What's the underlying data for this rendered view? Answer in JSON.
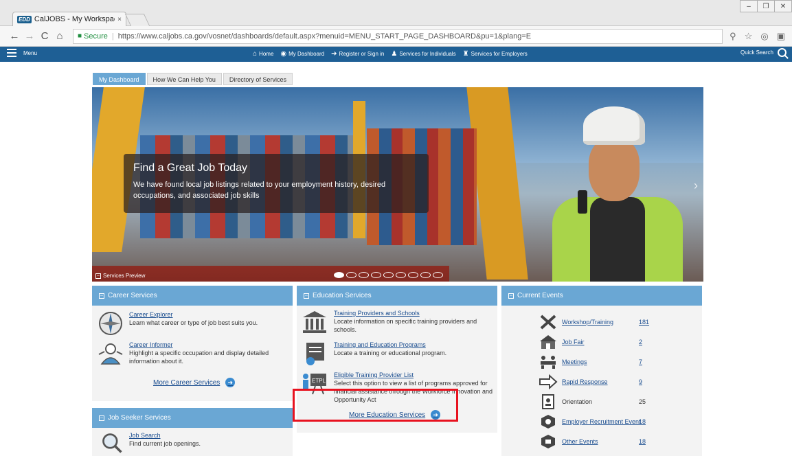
{
  "browser": {
    "tab_favicon": "EDD",
    "tab_title": "CalJOBS - My Workspace",
    "tab_close": "×",
    "secure_label": "Secure",
    "url": "https://www.caljobs.ca.gov/vosnet/dashboards/default.aspx?menuid=MENU_START_PAGE_DASHBOARD&pu=1&plang=E",
    "window_controls": [
      "–",
      "❐",
      "✕"
    ]
  },
  "site_nav": {
    "menu_label": "Menu",
    "links": [
      {
        "icon": "⌂",
        "label": "Home"
      },
      {
        "icon": "◉",
        "label": "My Dashboard"
      },
      {
        "icon": "➔",
        "label": "Register or Sign in"
      },
      {
        "icon": "♟",
        "label": "Services for Individuals"
      },
      {
        "icon": "♜",
        "label": "Services for Employers"
      }
    ],
    "quick_search_label": "Quick Search"
  },
  "page_tabs": [
    "My Dashboard",
    "How We Can Help You",
    "Directory of Services"
  ],
  "hero": {
    "title": "Find a Great Job Today",
    "text": "We have found local job listings related to your employment history, desired occupations, and associated job skills",
    "services_preview_label": "Services Preview",
    "slide_count": 9,
    "active_slide": 1
  },
  "career_services": {
    "heading": "Career Services",
    "items": [
      {
        "link": "Career Explorer",
        "desc": "Learn what career or type of job best suits you."
      },
      {
        "link": "Career Informer",
        "desc": "Highlight a specific occupation and display detailed information about it."
      }
    ],
    "more_label": "More Career Services"
  },
  "job_seeker_services": {
    "heading": "Job Seeker Services",
    "items": [
      {
        "link": "Job Search",
        "desc": "Find current job openings."
      }
    ]
  },
  "education_services": {
    "heading": "Education Services",
    "items": [
      {
        "link": "Training Providers and Schools",
        "desc": "Locate information on specific training providers and schools."
      },
      {
        "link": "Training and Education Programs",
        "desc": "Locate a training or educational program."
      },
      {
        "link": "Eligible Training Provider List",
        "desc": "Select this option to view a list of programs approved for financial assistance through the Workforce Innovation and Opportunity Act"
      }
    ],
    "more_label": "More Education Services"
  },
  "current_events": {
    "heading": "Current Events",
    "events": [
      {
        "name": "Workshop/Training",
        "count": "181",
        "linked": true
      },
      {
        "name": "Job Fair",
        "count": "2",
        "linked": true
      },
      {
        "name": "Meetings",
        "count": "7",
        "linked": true
      },
      {
        "name": "Rapid Response",
        "count": "9",
        "linked": true
      },
      {
        "name": "Orientation",
        "count": "25",
        "linked": false
      },
      {
        "name": "Employer Recruitment Event",
        "count": "18",
        "linked": true
      },
      {
        "name": "Other Events",
        "count": "18",
        "linked": true
      }
    ]
  },
  "colors": {
    "nav_blue": "#1e5f95",
    "panel_blue": "#6aa7d4",
    "link_blue": "#1a4d8f",
    "highlight_red": "#e8121f"
  }
}
